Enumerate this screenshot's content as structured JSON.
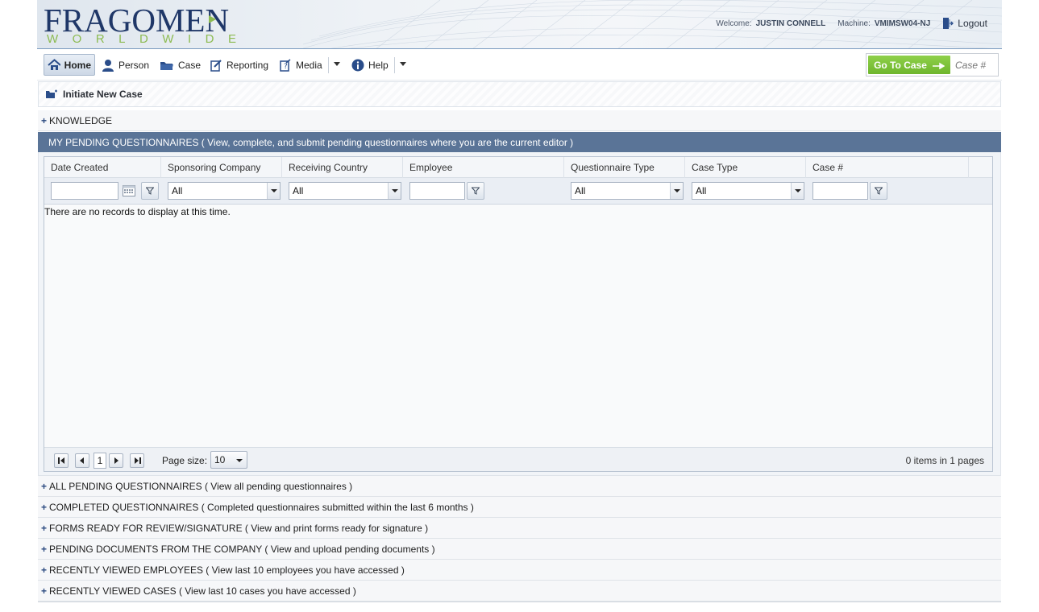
{
  "header": {
    "logo_main": "FRAGOMEN",
    "logo_sub": "WORLDWIDE",
    "welcome_label": "Welcome:",
    "user_name": "JUSTIN CONNELL",
    "machine_label": "Machine:",
    "machine_name": "VMIMSW04-NJ",
    "logout_label": "Logout"
  },
  "menu": {
    "items": [
      {
        "label": "Home",
        "icon": "home-icon"
      },
      {
        "label": "Person",
        "icon": "person-icon"
      },
      {
        "label": "Case",
        "icon": "folder-icon"
      },
      {
        "label": "Reporting",
        "icon": "reporting-icon"
      },
      {
        "label": "Media",
        "icon": "media-icon"
      },
      {
        "label": "Help",
        "icon": "info-icon"
      }
    ],
    "goto_label": "Go To Case",
    "case_placeholder": "Case #"
  },
  "initiate_label": "Initiate New Case",
  "sections": {
    "knowledge": "KNOWLEDGE",
    "active": "MY PENDING QUESTIONNAIRES ( View, complete, and submit pending questionnaires where you are the current editor )",
    "collapsed": [
      "ALL PENDING QUESTIONNAIRES ( View all pending questionnaires )",
      "COMPLETED QUESTIONNAIRES ( Completed questionnaires submitted within the last 6 months )",
      "FORMS READY FOR REVIEW/SIGNATURE ( View and print forms ready for signature )",
      "PENDING DOCUMENTS FROM THE COMPANY ( View and upload pending documents )",
      "RECENTLY VIEWED EMPLOYEES ( View last 10 employees you have accessed )",
      "RECENTLY VIEWED CASES ( View last 10 cases you have accessed )"
    ]
  },
  "grid": {
    "columns": [
      "Date Created",
      "Sponsoring Company",
      "Receiving Country",
      "Employee",
      "Questionnaire Type",
      "Case Type",
      "Case #"
    ],
    "filter_select_value": "All",
    "empty_message": "There are no records to display at this time.",
    "current_page": "1",
    "page_size_label": "Page size:",
    "page_size": "10",
    "items_info": "0 items in 1 pages"
  },
  "colors": {
    "brand_navy": "#1f3768",
    "brand_green": "#8dbb52",
    "active_section": "#5a7497",
    "goto_button": "#7cc23a"
  }
}
